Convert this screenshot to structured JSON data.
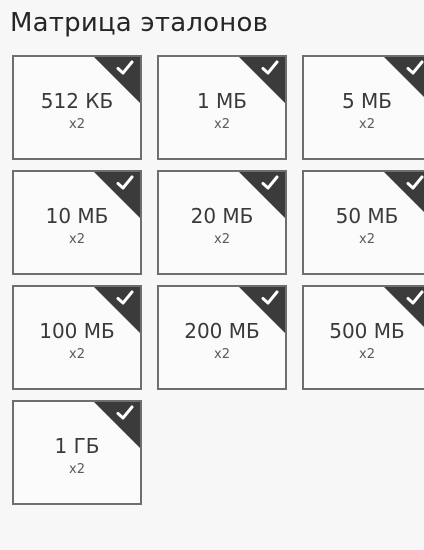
{
  "header": {
    "title": "Матрица эталонов"
  },
  "tiles": [
    {
      "size": "512 КБ",
      "count": "x2",
      "checked": true
    },
    {
      "size": "1 МБ",
      "count": "x2",
      "checked": true
    },
    {
      "size": "5 МБ",
      "count": "x2",
      "checked": true
    },
    {
      "size": "10 МБ",
      "count": "x2",
      "checked": true
    },
    {
      "size": "20 МБ",
      "count": "x2",
      "checked": true
    },
    {
      "size": "50 МБ",
      "count": "x2",
      "checked": true
    },
    {
      "size": "100 МБ",
      "count": "x2",
      "checked": true
    },
    {
      "size": "200 МБ",
      "count": "x2",
      "checked": true
    },
    {
      "size": "500 МБ",
      "count": "x2",
      "checked": true
    },
    {
      "size": "1 ГБ",
      "count": "x2",
      "checked": true
    }
  ],
  "icons": {
    "check": "checkmark-icon"
  },
  "colors": {
    "tile_border": "#6e6e6e",
    "corner": "#3b3b3b",
    "check": "#ffffff",
    "text": "#262626"
  }
}
